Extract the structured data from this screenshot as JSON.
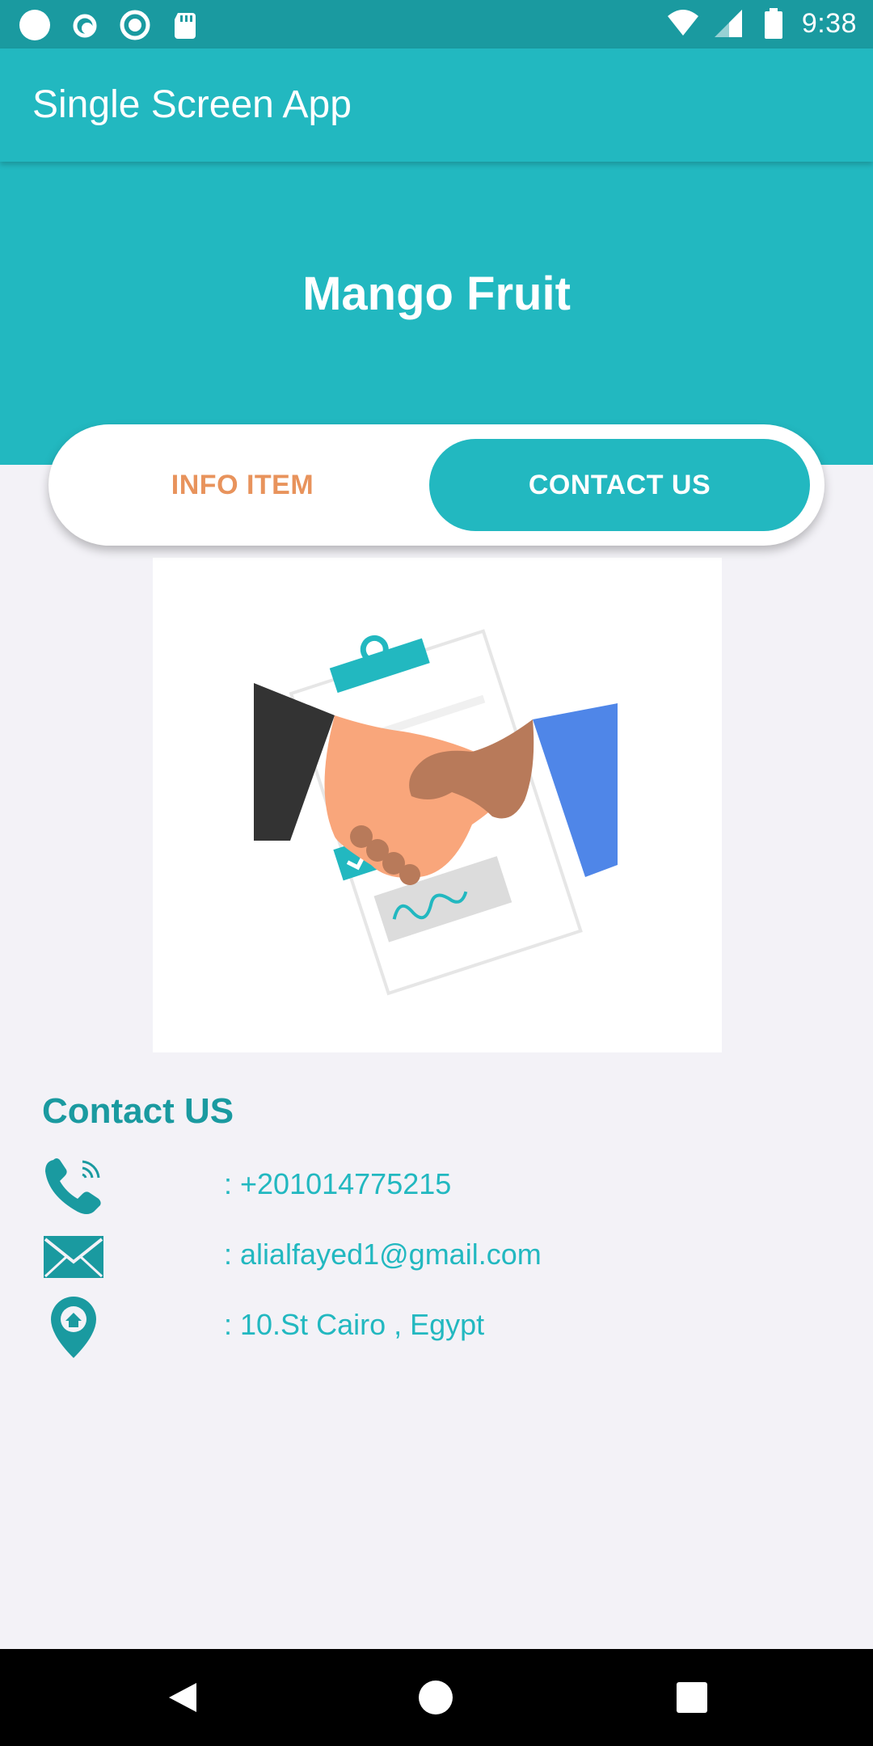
{
  "status_bar": {
    "time": "9:38",
    "icons": [
      "circle-icon",
      "sync-icon",
      "radio-icon",
      "sd-card-icon",
      "wifi-icon",
      "signal-icon",
      "battery-icon"
    ]
  },
  "app_bar": {
    "title": "Single Screen App"
  },
  "hero": {
    "title": "Mango Fruit"
  },
  "tabs": [
    {
      "label": "INFO ITEM",
      "selected": false
    },
    {
      "label": "CONTACT US",
      "selected": true
    }
  ],
  "contact": {
    "heading": "Contact US",
    "items": [
      {
        "icon": "phone-icon",
        "text": ": +201014775215"
      },
      {
        "icon": "mail-icon",
        "text": ": alialfayed1@gmail.com"
      },
      {
        "icon": "location-icon",
        "text": ": 10.St Cairo , Egypt"
      }
    ]
  },
  "nav_bar": {
    "buttons": [
      "back-icon",
      "home-icon",
      "recents-icon"
    ]
  },
  "colors": {
    "primary": "#22b8c0",
    "primary_dark": "#1a9aa0",
    "accent": "#e8935c",
    "background": "#f3f2f7"
  }
}
